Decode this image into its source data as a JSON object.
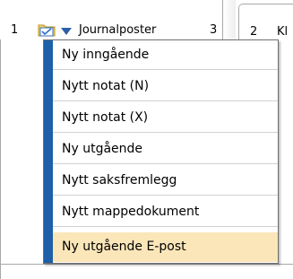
{
  "tabs": [
    {
      "number": "1",
      "label": "Journalposter",
      "count": "3",
      "active": true
    },
    {
      "number": "2",
      "label": "Kl",
      "active": false
    }
  ],
  "icons": {
    "tab_icon": "folder-check-icon",
    "dropdown": "chevron-down-icon"
  },
  "colors": {
    "menu_gutter": "#1d5fa8",
    "hover": "#fbe6b9",
    "border": "#a8a8a8"
  },
  "menu": {
    "items": [
      {
        "label": "Ny inngående"
      },
      {
        "label": "Nytt notat (N)"
      },
      {
        "label": "Nytt notat (X)"
      },
      {
        "label": "Ny utgående"
      },
      {
        "label": "Nytt saksfremlegg"
      },
      {
        "label": "Nytt mappedokument"
      },
      {
        "label": "Ny utgående E-post",
        "highlighted": true
      }
    ]
  }
}
